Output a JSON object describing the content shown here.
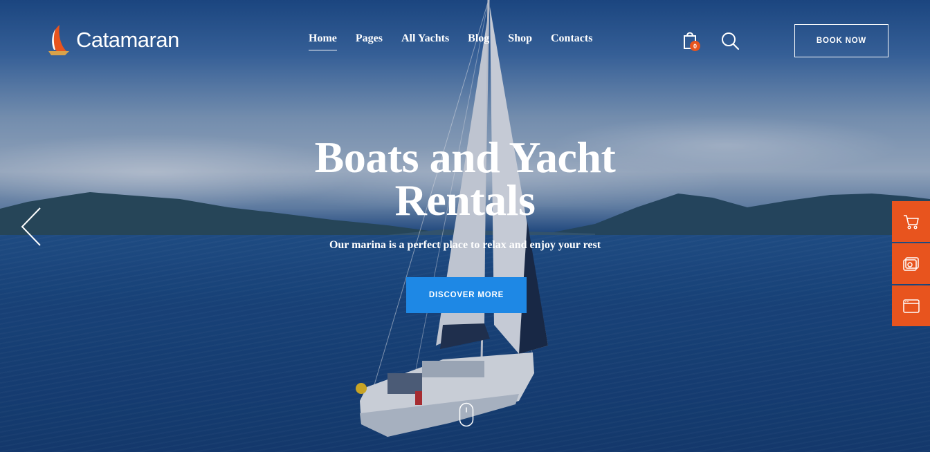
{
  "brand": {
    "name": "Catamaran"
  },
  "nav": {
    "items": [
      {
        "label": "Home",
        "active": true
      },
      {
        "label": "Pages",
        "active": false
      },
      {
        "label": "All Yachts",
        "active": false
      },
      {
        "label": "Blog",
        "active": false
      },
      {
        "label": "Shop",
        "active": false
      },
      {
        "label": "Contacts",
        "active": false
      }
    ]
  },
  "header": {
    "cart_count": "0",
    "book_label": "BOOK NOW"
  },
  "hero": {
    "title_line1": "Boats and Yacht",
    "title_line2": "Rentals",
    "subtitle": "Our marina is a perfect place to relax and enjoy your rest",
    "cta_label": "DISCOVER MORE"
  },
  "icons": {
    "cart": "shopping-bag-icon",
    "search": "search-icon",
    "prev": "chevron-left-icon",
    "scroll": "mouse-scroll-icon",
    "side": [
      "cart-icon",
      "gallery-icon",
      "browser-window-icon"
    ]
  },
  "colors": {
    "accent_orange": "#e8541e",
    "cta_blue": "#1e88e5"
  }
}
